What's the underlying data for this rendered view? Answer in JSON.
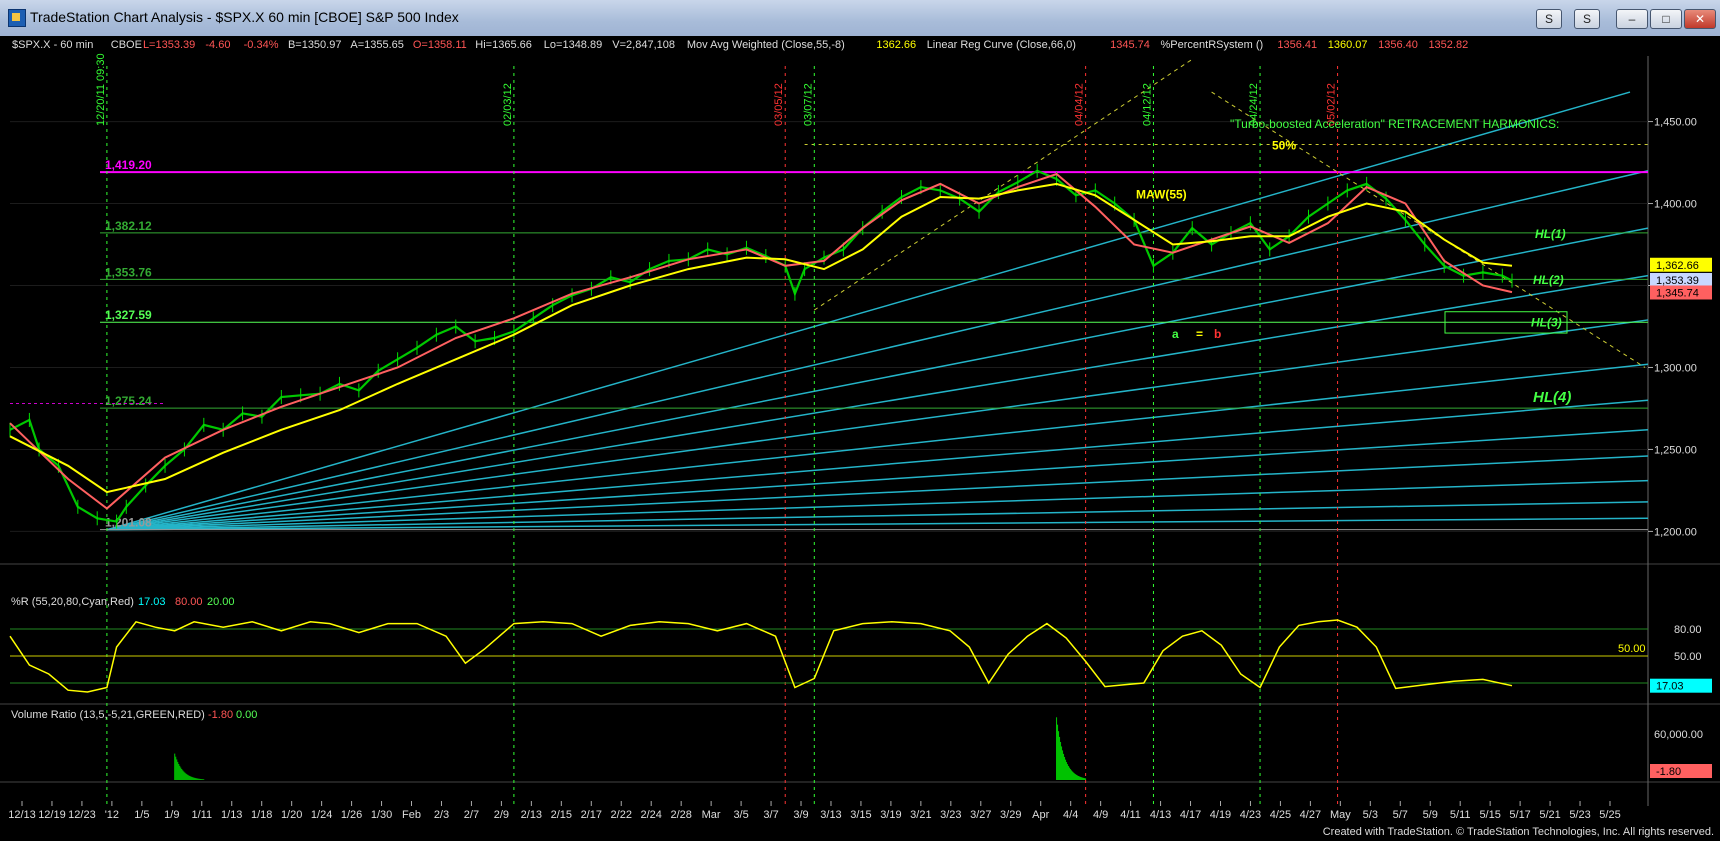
{
  "window": {
    "title": "TradeStation Chart Analysis - $SPX.X 60 min [CBOE] S&P 500 Index",
    "btn_s1": "S",
    "btn_s2": "S",
    "btn_min": "–",
    "btn_max": "□",
    "btn_close": "✕"
  },
  "footer": "Created with TradeStation. © TradeStation Technologies, Inc. All rights reserved.",
  "colors": {
    "background": "#000000",
    "price_bar": "#00c800",
    "maw55": "#ffff00",
    "linreg": "#ff6060",
    "magenta": "#ff00ff",
    "fan": "#24b4c8",
    "percent_r": "#ffff00",
    "volume": "#00cc00"
  },
  "chart_data": [
    {
      "type": "line",
      "panel": "price",
      "header": {
        "symbol": "$SPX.X - 60 min",
        "exchange": "CBOE",
        "last": "L=1353.39",
        "change": "-4.60",
        "change_pct": "-0.34%",
        "bid": "B=1350.97",
        "ask": "A=1355.65",
        "open": "O=1358.11",
        "high": "Hi=1365.66",
        "low": "Lo=1348.89",
        "volume": "V=2,847,108",
        "maw_label": "Mov Avg Weighted (Close,55,-8)",
        "maw_value": "1362.66",
        "linreg_label": "Linear Reg Curve (Close,66,0)",
        "linreg_value": "1345.74",
        "pr_label": "%PercentRSystem ()",
        "pr_values": [
          "1356.41",
          "1360.07",
          "1356.40",
          "1352.82"
        ]
      },
      "ylim": [
        1185,
        1490
      ],
      "y_ticks": [
        "1,450.00",
        "1,400.00",
        "1,350.00",
        "1,300.00",
        "1,250.00",
        "1,200.00"
      ],
      "x_ticks": [
        "12/13",
        "12/19",
        "12/23",
        "'12",
        "1/5",
        "1/9",
        "1/11",
        "1/13",
        "1/18",
        "1/20",
        "1/24",
        "1/26",
        "1/30",
        "Feb",
        "2/3",
        "2/7",
        "2/9",
        "2/13",
        "2/15",
        "2/17",
        "2/22",
        "2/24",
        "2/28",
        "Mar",
        "3/5",
        "3/7",
        "3/9",
        "3/13",
        "3/15",
        "3/19",
        "3/21",
        "3/23",
        "3/27",
        "3/29",
        "Apr",
        "4/4",
        "4/9",
        "4/11",
        "4/13",
        "4/17",
        "4/19",
        "4/23",
        "4/25",
        "4/27",
        "May",
        "5/3",
        "5/7",
        "5/9",
        "5/11",
        "5/15",
        "5/17",
        "5/21",
        "5/23",
        "5/25"
      ],
      "price_path": [
        [
          0,
          1262
        ],
        [
          2,
          1268
        ],
        [
          3,
          1250
        ],
        [
          5,
          1240
        ],
        [
          7,
          1215
        ],
        [
          9,
          1208
        ],
        [
          11,
          1206
        ],
        [
          12,
          1215
        ],
        [
          14,
          1228
        ],
        [
          16,
          1240
        ],
        [
          18,
          1250
        ],
        [
          20,
          1265
        ],
        [
          22,
          1262
        ],
        [
          24,
          1272
        ],
        [
          26,
          1270
        ],
        [
          28,
          1282
        ],
        [
          30,
          1283
        ],
        [
          32,
          1284
        ],
        [
          34,
          1290
        ],
        [
          36,
          1286
        ],
        [
          38,
          1298
        ],
        [
          40,
          1305
        ],
        [
          42,
          1312
        ],
        [
          44,
          1320
        ],
        [
          46,
          1325
        ],
        [
          48,
          1316
        ],
        [
          50,
          1318
        ],
        [
          52,
          1322
        ],
        [
          54,
          1330
        ],
        [
          56,
          1338
        ],
        [
          58,
          1344
        ],
        [
          60,
          1348
        ],
        [
          62,
          1355
        ],
        [
          64,
          1352
        ],
        [
          66,
          1360
        ],
        [
          68,
          1365
        ],
        [
          70,
          1366
        ],
        [
          72,
          1372
        ],
        [
          74,
          1369
        ],
        [
          76,
          1373
        ],
        [
          78,
          1368
        ],
        [
          80,
          1362
        ],
        [
          81,
          1345
        ],
        [
          82,
          1360
        ],
        [
          84,
          1367
        ],
        [
          86,
          1372
        ],
        [
          88,
          1385
        ],
        [
          90,
          1395
        ],
        [
          92,
          1404
        ],
        [
          94,
          1410
        ],
        [
          96,
          1408
        ],
        [
          98,
          1403
        ],
        [
          100,
          1395
        ],
        [
          102,
          1407
        ],
        [
          104,
          1413
        ],
        [
          106,
          1420
        ],
        [
          108,
          1415
        ],
        [
          110,
          1405
        ],
        [
          112,
          1408
        ],
        [
          114,
          1400
        ],
        [
          116,
          1390
        ],
        [
          118,
          1362
        ],
        [
          120,
          1370
        ],
        [
          122,
          1385
        ],
        [
          124,
          1375
        ],
        [
          126,
          1382
        ],
        [
          128,
          1388
        ],
        [
          130,
          1372
        ],
        [
          132,
          1380
        ],
        [
          134,
          1392
        ],
        [
          136,
          1400
        ],
        [
          138,
          1408
        ],
        [
          140,
          1412
        ],
        [
          142,
          1403
        ],
        [
          144,
          1390
        ],
        [
          146,
          1375
        ],
        [
          148,
          1362
        ],
        [
          150,
          1356
        ],
        [
          152,
          1358
        ],
        [
          154,
          1356
        ],
        [
          155,
          1353
        ]
      ],
      "maw55_path": [
        [
          0,
          1258
        ],
        [
          6,
          1240
        ],
        [
          10,
          1224
        ],
        [
          16,
          1232
        ],
        [
          22,
          1248
        ],
        [
          28,
          1262
        ],
        [
          34,
          1274
        ],
        [
          40,
          1290
        ],
        [
          46,
          1305
        ],
        [
          52,
          1320
        ],
        [
          58,
          1338
        ],
        [
          64,
          1350
        ],
        [
          70,
          1360
        ],
        [
          76,
          1367
        ],
        [
          80,
          1366
        ],
        [
          84,
          1360
        ],
        [
          88,
          1372
        ],
        [
          92,
          1392
        ],
        [
          96,
          1404
        ],
        [
          100,
          1403
        ],
        [
          104,
          1408
        ],
        [
          108,
          1412
        ],
        [
          112,
          1405
        ],
        [
          116,
          1390
        ],
        [
          120,
          1375
        ],
        [
          124,
          1377
        ],
        [
          128,
          1380
        ],
        [
          132,
          1380
        ],
        [
          136,
          1392
        ],
        [
          140,
          1400
        ],
        [
          144,
          1395
        ],
        [
          148,
          1378
        ],
        [
          152,
          1364
        ],
        [
          155,
          1362
        ]
      ],
      "linreg_path": [
        [
          0,
          1266
        ],
        [
          6,
          1232
        ],
        [
          10,
          1214
        ],
        [
          16,
          1245
        ],
        [
          22,
          1262
        ],
        [
          28,
          1276
        ],
        [
          34,
          1288
        ],
        [
          40,
          1300
        ],
        [
          46,
          1318
        ],
        [
          52,
          1330
        ],
        [
          58,
          1345
        ],
        [
          64,
          1355
        ],
        [
          70,
          1366
        ],
        [
          76,
          1372
        ],
        [
          80,
          1362
        ],
        [
          84,
          1365
        ],
        [
          88,
          1385
        ],
        [
          92,
          1402
        ],
        [
          96,
          1412
        ],
        [
          100,
          1400
        ],
        [
          104,
          1410
        ],
        [
          108,
          1418
        ],
        [
          112,
          1398
        ],
        [
          116,
          1375
        ],
        [
          120,
          1370
        ],
        [
          124,
          1378
        ],
        [
          128,
          1386
        ],
        [
          132,
          1376
        ],
        [
          136,
          1388
        ],
        [
          140,
          1410
        ],
        [
          144,
          1400
        ],
        [
          148,
          1365
        ],
        [
          152,
          1350
        ],
        [
          155,
          1346
        ]
      ],
      "horizontal_levels": [
        {
          "label": "1,419.20",
          "value": 1419.2,
          "color": "#ff00ff"
        },
        {
          "label": "1,382.12",
          "value": 1382.12,
          "color": "#33aa33"
        },
        {
          "label": "1,353.76",
          "value": 1353.76,
          "color": "#33aa33"
        },
        {
          "label": "1,327.59",
          "value": 1327.59,
          "color": "#55ff55"
        },
        {
          "label": "1,275.24",
          "value": 1275.24,
          "color": "#33aa33"
        },
        {
          "label": "1,201.08",
          "value": 1201.08,
          "color": "#999999"
        }
      ],
      "date_markers": [
        {
          "label": "12/20/11 09:30",
          "x": 10,
          "color": "#33ff33"
        },
        {
          "label": "02/03/12",
          "x": 52,
          "color": "#33ff33"
        },
        {
          "label": "03/05/12",
          "x": 80,
          "color": "#ff3333"
        },
        {
          "label": "03/07/12",
          "x": 83,
          "color": "#33ff33"
        },
        {
          "label": "04/04/12",
          "x": 111,
          "color": "#ff3333"
        },
        {
          "label": "04/12/12",
          "x": 118,
          "color": "#33ff33"
        },
        {
          "label": "04/24/12",
          "x": 129,
          "color": "#33ff33"
        },
        {
          "label": "05/02/12",
          "x": 137,
          "color": "#ff3333"
        }
      ],
      "annotations": {
        "harmonics_title": "\"Turbo-boosted Acceleration\" RETRACEMENT HARMONICS:",
        "harmonics_pct": "50%",
        "maw_tag": "MAW(55)",
        "hl1": "HL(1)",
        "hl2": "HL(2)",
        "hl3": "HL(3)",
        "hl4": "HL(4)",
        "a": "a",
        "eq": "=",
        "b": "b"
      },
      "axis_tags": [
        {
          "label": "1,362.66",
          "value": 1362.66,
          "bg": "#ffff00",
          "fg": "#000000"
        },
        {
          "label": "1,353.39",
          "value": 1353.39,
          "bg": "#c8d8ff",
          "fg": "#000000"
        },
        {
          "label": "1,345.74",
          "value": 1345.74,
          "bg": "#ff6060",
          "fg": "#000000"
        }
      ]
    },
    {
      "type": "line",
      "panel": "percent_r",
      "label": "%R (55,20,80,Cyan,Red)",
      "value": "17.03",
      "overbought": "80.00",
      "oversold": "20.00",
      "ylim": [
        0,
        100
      ],
      "y_ticks": [
        "80.00",
        "50.00"
      ],
      "mid_label": "50.00",
      "axis_tag": "17.03",
      "values": [
        [
          0,
          72
        ],
        [
          2,
          40
        ],
        [
          4,
          30
        ],
        [
          6,
          12
        ],
        [
          8,
          10
        ],
        [
          10,
          15
        ],
        [
          11,
          60
        ],
        [
          13,
          88
        ],
        [
          15,
          82
        ],
        [
          17,
          78
        ],
        [
          19,
          88
        ],
        [
          22,
          82
        ],
        [
          25,
          88
        ],
        [
          28,
          78
        ],
        [
          31,
          88
        ],
        [
          33,
          86
        ],
        [
          36,
          76
        ],
        [
          39,
          86
        ],
        [
          42,
          86
        ],
        [
          45,
          72
        ],
        [
          47,
          42
        ],
        [
          49,
          58
        ],
        [
          52,
          86
        ],
        [
          55,
          88
        ],
        [
          58,
          86
        ],
        [
          61,
          72
        ],
        [
          64,
          84
        ],
        [
          67,
          88
        ],
        [
          70,
          86
        ],
        [
          73,
          78
        ],
        [
          76,
          86
        ],
        [
          79,
          72
        ],
        [
          81,
          15
        ],
        [
          83,
          25
        ],
        [
          85,
          78
        ],
        [
          88,
          86
        ],
        [
          91,
          88
        ],
        [
          94,
          86
        ],
        [
          97,
          78
        ],
        [
          99,
          60
        ],
        [
          101,
          20
        ],
        [
          103,
          52
        ],
        [
          105,
          72
        ],
        [
          107,
          86
        ],
        [
          109,
          70
        ],
        [
          111,
          44
        ],
        [
          113,
          16
        ],
        [
          115,
          18
        ],
        [
          117,
          20
        ],
        [
          119,
          56
        ],
        [
          121,
          72
        ],
        [
          123,
          78
        ],
        [
          125,
          62
        ],
        [
          127,
          30
        ],
        [
          129,
          15
        ],
        [
          131,
          60
        ],
        [
          133,
          84
        ],
        [
          135,
          88
        ],
        [
          137,
          90
        ],
        [
          139,
          82
        ],
        [
          141,
          60
        ],
        [
          143,
          14
        ],
        [
          146,
          18
        ],
        [
          149,
          22
        ],
        [
          152,
          24
        ],
        [
          155,
          17
        ]
      ]
    },
    {
      "type": "bar",
      "panel": "volume_ratio",
      "label": "Volume Ratio (13,5,-5,21,GREEN,RED)",
      "value": "-1.80",
      "zero": "0.00",
      "y_ticks": [
        "60,000.00"
      ],
      "axis_tag": "-1.80",
      "spikes": [
        {
          "x": 17,
          "height": 0.4
        },
        {
          "x": 108,
          "height": 0.95
        }
      ]
    }
  ]
}
